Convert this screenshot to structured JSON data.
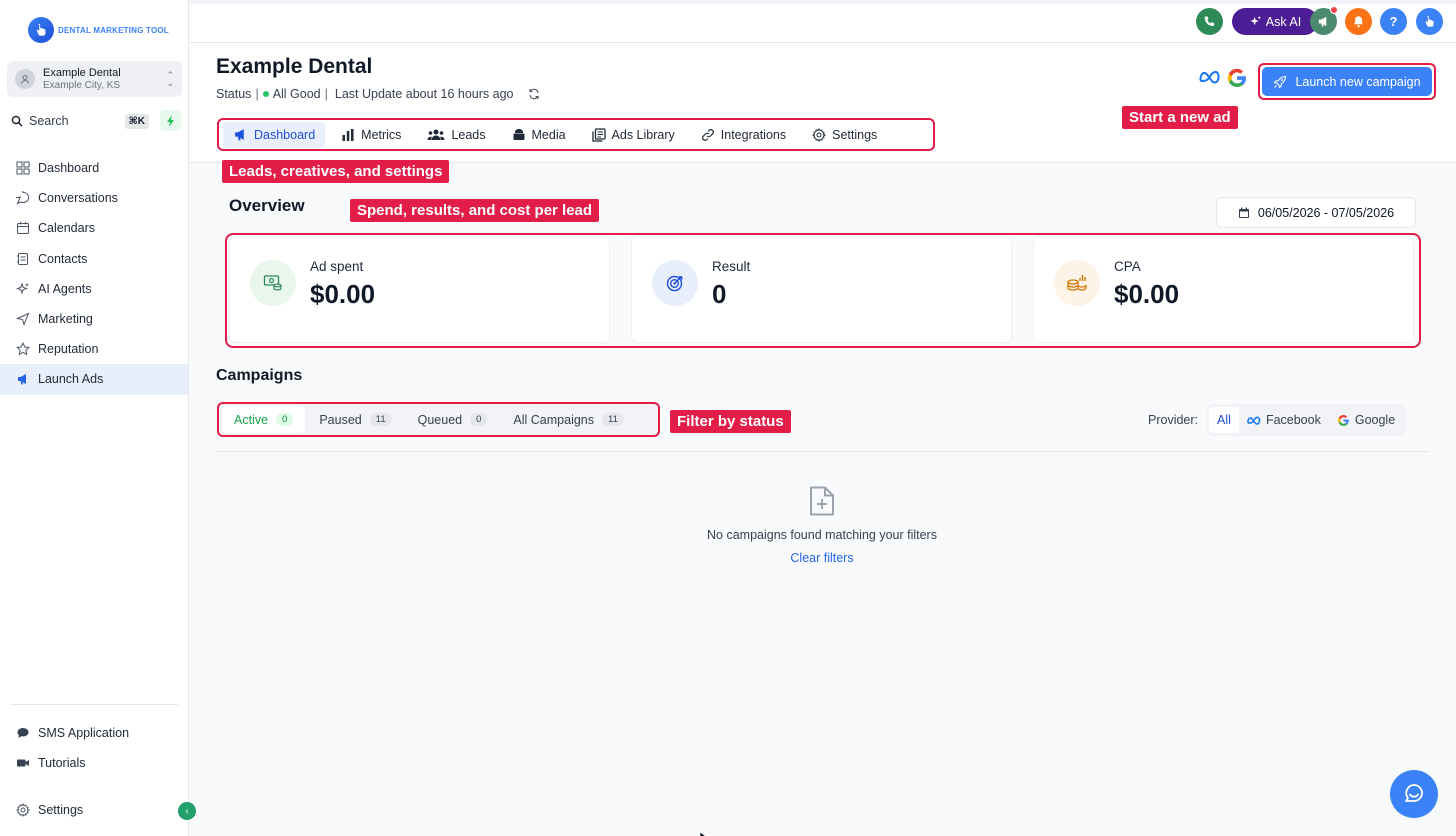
{
  "app": {
    "brand_primary": "DENTAL",
    "brand_secondary": "MARKETING TOOL"
  },
  "account": {
    "name": "Example Dental",
    "location": "Example City, KS"
  },
  "search": {
    "label": "Search",
    "shortcut": "⌘K"
  },
  "sidebar": {
    "items": [
      {
        "label": "Dashboard",
        "icon": "grid-icon"
      },
      {
        "label": "Conversations",
        "icon": "chat-bubble-icon"
      },
      {
        "label": "Calendars",
        "icon": "calendar-icon"
      },
      {
        "label": "Contacts",
        "icon": "contacts-icon"
      },
      {
        "label": "AI Agents",
        "icon": "sparkle-icon"
      },
      {
        "label": "Marketing",
        "icon": "send-icon"
      },
      {
        "label": "Reputation",
        "icon": "star-icon"
      },
      {
        "label": "Launch Ads",
        "icon": "megaphone-icon",
        "active": true
      }
    ],
    "bottom_items": [
      {
        "label": "SMS Application",
        "icon": "sms-icon"
      },
      {
        "label": "Tutorials",
        "icon": "video-icon"
      }
    ],
    "settings_label": "Settings"
  },
  "topbar": {
    "ask_ai_label": "Ask AI"
  },
  "page": {
    "title": "Example Dental",
    "status_label": "Status",
    "status_value": "All Good",
    "last_update": "Last Update about 16 hours ago",
    "launch_label": "Launch new campaign"
  },
  "tabs": [
    {
      "label": "Dashboard",
      "icon": "megaphone-icon",
      "active": true
    },
    {
      "label": "Metrics",
      "icon": "bar-chart-icon"
    },
    {
      "label": "Leads",
      "icon": "users-icon"
    },
    {
      "label": "Media",
      "icon": "media-icon"
    },
    {
      "label": "Ads Library",
      "icon": "library-icon"
    },
    {
      "label": "Integrations",
      "icon": "link-icon"
    },
    {
      "label": "Settings",
      "icon": "gear-icon"
    }
  ],
  "callouts": {
    "start_ad": "Start a new ad",
    "tabs": "Leads, creatives, and settings",
    "overview": "Spend, results, and cost per lead",
    "filter": "Filter by status"
  },
  "overview": {
    "title": "Overview",
    "date_range": "06/05/2026 - 07/05/2026",
    "cards": [
      {
        "label": "Ad spent",
        "value": "$0.00",
        "icon": "money-icon"
      },
      {
        "label": "Result",
        "value": "0",
        "icon": "target-icon"
      },
      {
        "label": "CPA",
        "value": "$0.00",
        "icon": "coins-icon"
      }
    ]
  },
  "campaigns": {
    "title": "Campaigns",
    "filters": [
      {
        "label": "Active",
        "count": "0",
        "active": true
      },
      {
        "label": "Paused",
        "count": "11"
      },
      {
        "label": "Queued",
        "count": "0"
      },
      {
        "label": "All Campaigns",
        "count": "11"
      }
    ],
    "provider_label": "Provider:",
    "providers": [
      {
        "label": "All",
        "active": true
      },
      {
        "label": "Facebook"
      },
      {
        "label": "Google"
      }
    ],
    "empty_text": "No campaigns found matching your filters",
    "clear_label": "Clear filters"
  },
  "colors": {
    "accent": "#3b82f6",
    "callout": "#e11d48",
    "ask_ai": "#4c1d95",
    "success": "#22c55e"
  }
}
